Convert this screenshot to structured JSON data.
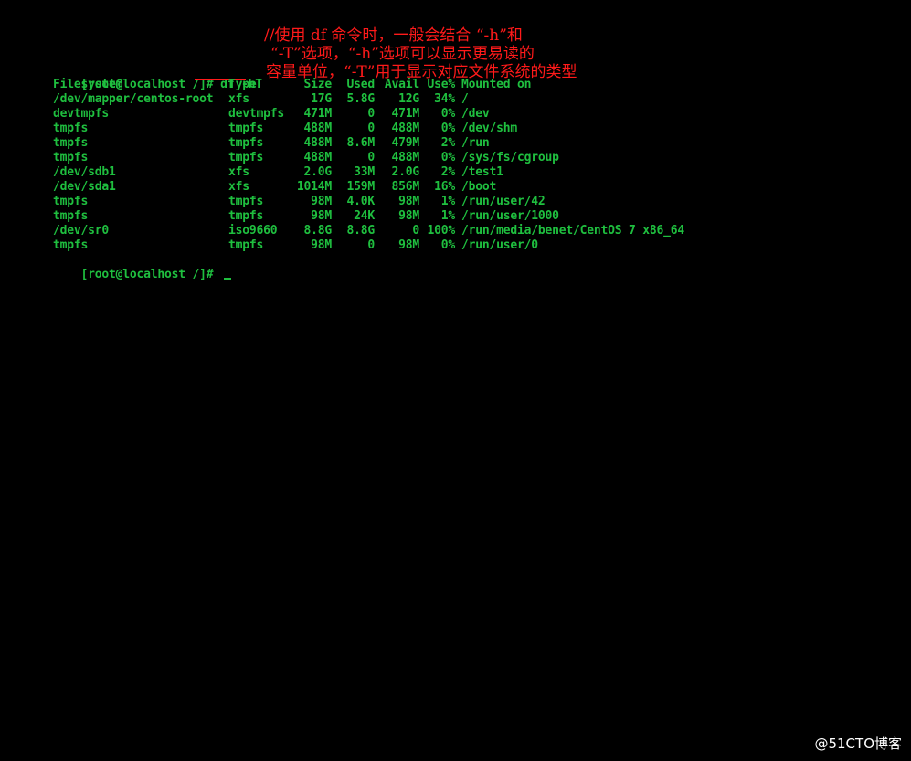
{
  "terminal": {
    "prompt": "[root@localhost /]# ",
    "command": "df -hT",
    "final_prompt": "[root@localhost /]# ",
    "headers": [
      "Filesystem",
      "Type",
      "Size",
      "Used",
      "Avail",
      "Use%",
      "Mounted on"
    ],
    "rows": [
      [
        "/dev/mapper/centos-root",
        "xfs",
        "17G",
        "5.8G",
        "12G",
        "34%",
        "/"
      ],
      [
        "devtmpfs",
        "devtmpfs",
        "471M",
        "0",
        "471M",
        "0%",
        "/dev"
      ],
      [
        "tmpfs",
        "tmpfs",
        "488M",
        "0",
        "488M",
        "0%",
        "/dev/shm"
      ],
      [
        "tmpfs",
        "tmpfs",
        "488M",
        "8.6M",
        "479M",
        "2%",
        "/run"
      ],
      [
        "tmpfs",
        "tmpfs",
        "488M",
        "0",
        "488M",
        "0%",
        "/sys/fs/cgroup"
      ],
      [
        "/dev/sdb1",
        "xfs",
        "2.0G",
        "33M",
        "2.0G",
        "2%",
        "/test1"
      ],
      [
        "/dev/sda1",
        "xfs",
        "1014M",
        "159M",
        "856M",
        "16%",
        "/boot"
      ],
      [
        "tmpfs",
        "tmpfs",
        "98M",
        "4.0K",
        "98M",
        "1%",
        "/run/user/42"
      ],
      [
        "tmpfs",
        "tmpfs",
        "98M",
        "24K",
        "98M",
        "1%",
        "/run/user/1000"
      ],
      [
        "/dev/sr0",
        "iso9660",
        "8.8G",
        "8.8G",
        "0",
        "100%",
        "/run/media/benet/CentOS 7 x86_64"
      ],
      [
        "tmpfs",
        "tmpfs",
        "98M",
        "0",
        "98M",
        "0%",
        "/run/user/0"
      ]
    ]
  },
  "annotation": {
    "lines": [
      "//使用 df 命令时，一般会结合 “-h”和",
      "“-T”选项，“-h”选项可以显示更易读的",
      "容量单位，“-T”用于显示对应文件系统的类型"
    ]
  },
  "watermark": "@51CTO博客",
  "colors": {
    "background": "#000000",
    "terminal_text": "#1fbf3f",
    "annotation": "#ff1a1a",
    "watermark": "#ffffff"
  }
}
